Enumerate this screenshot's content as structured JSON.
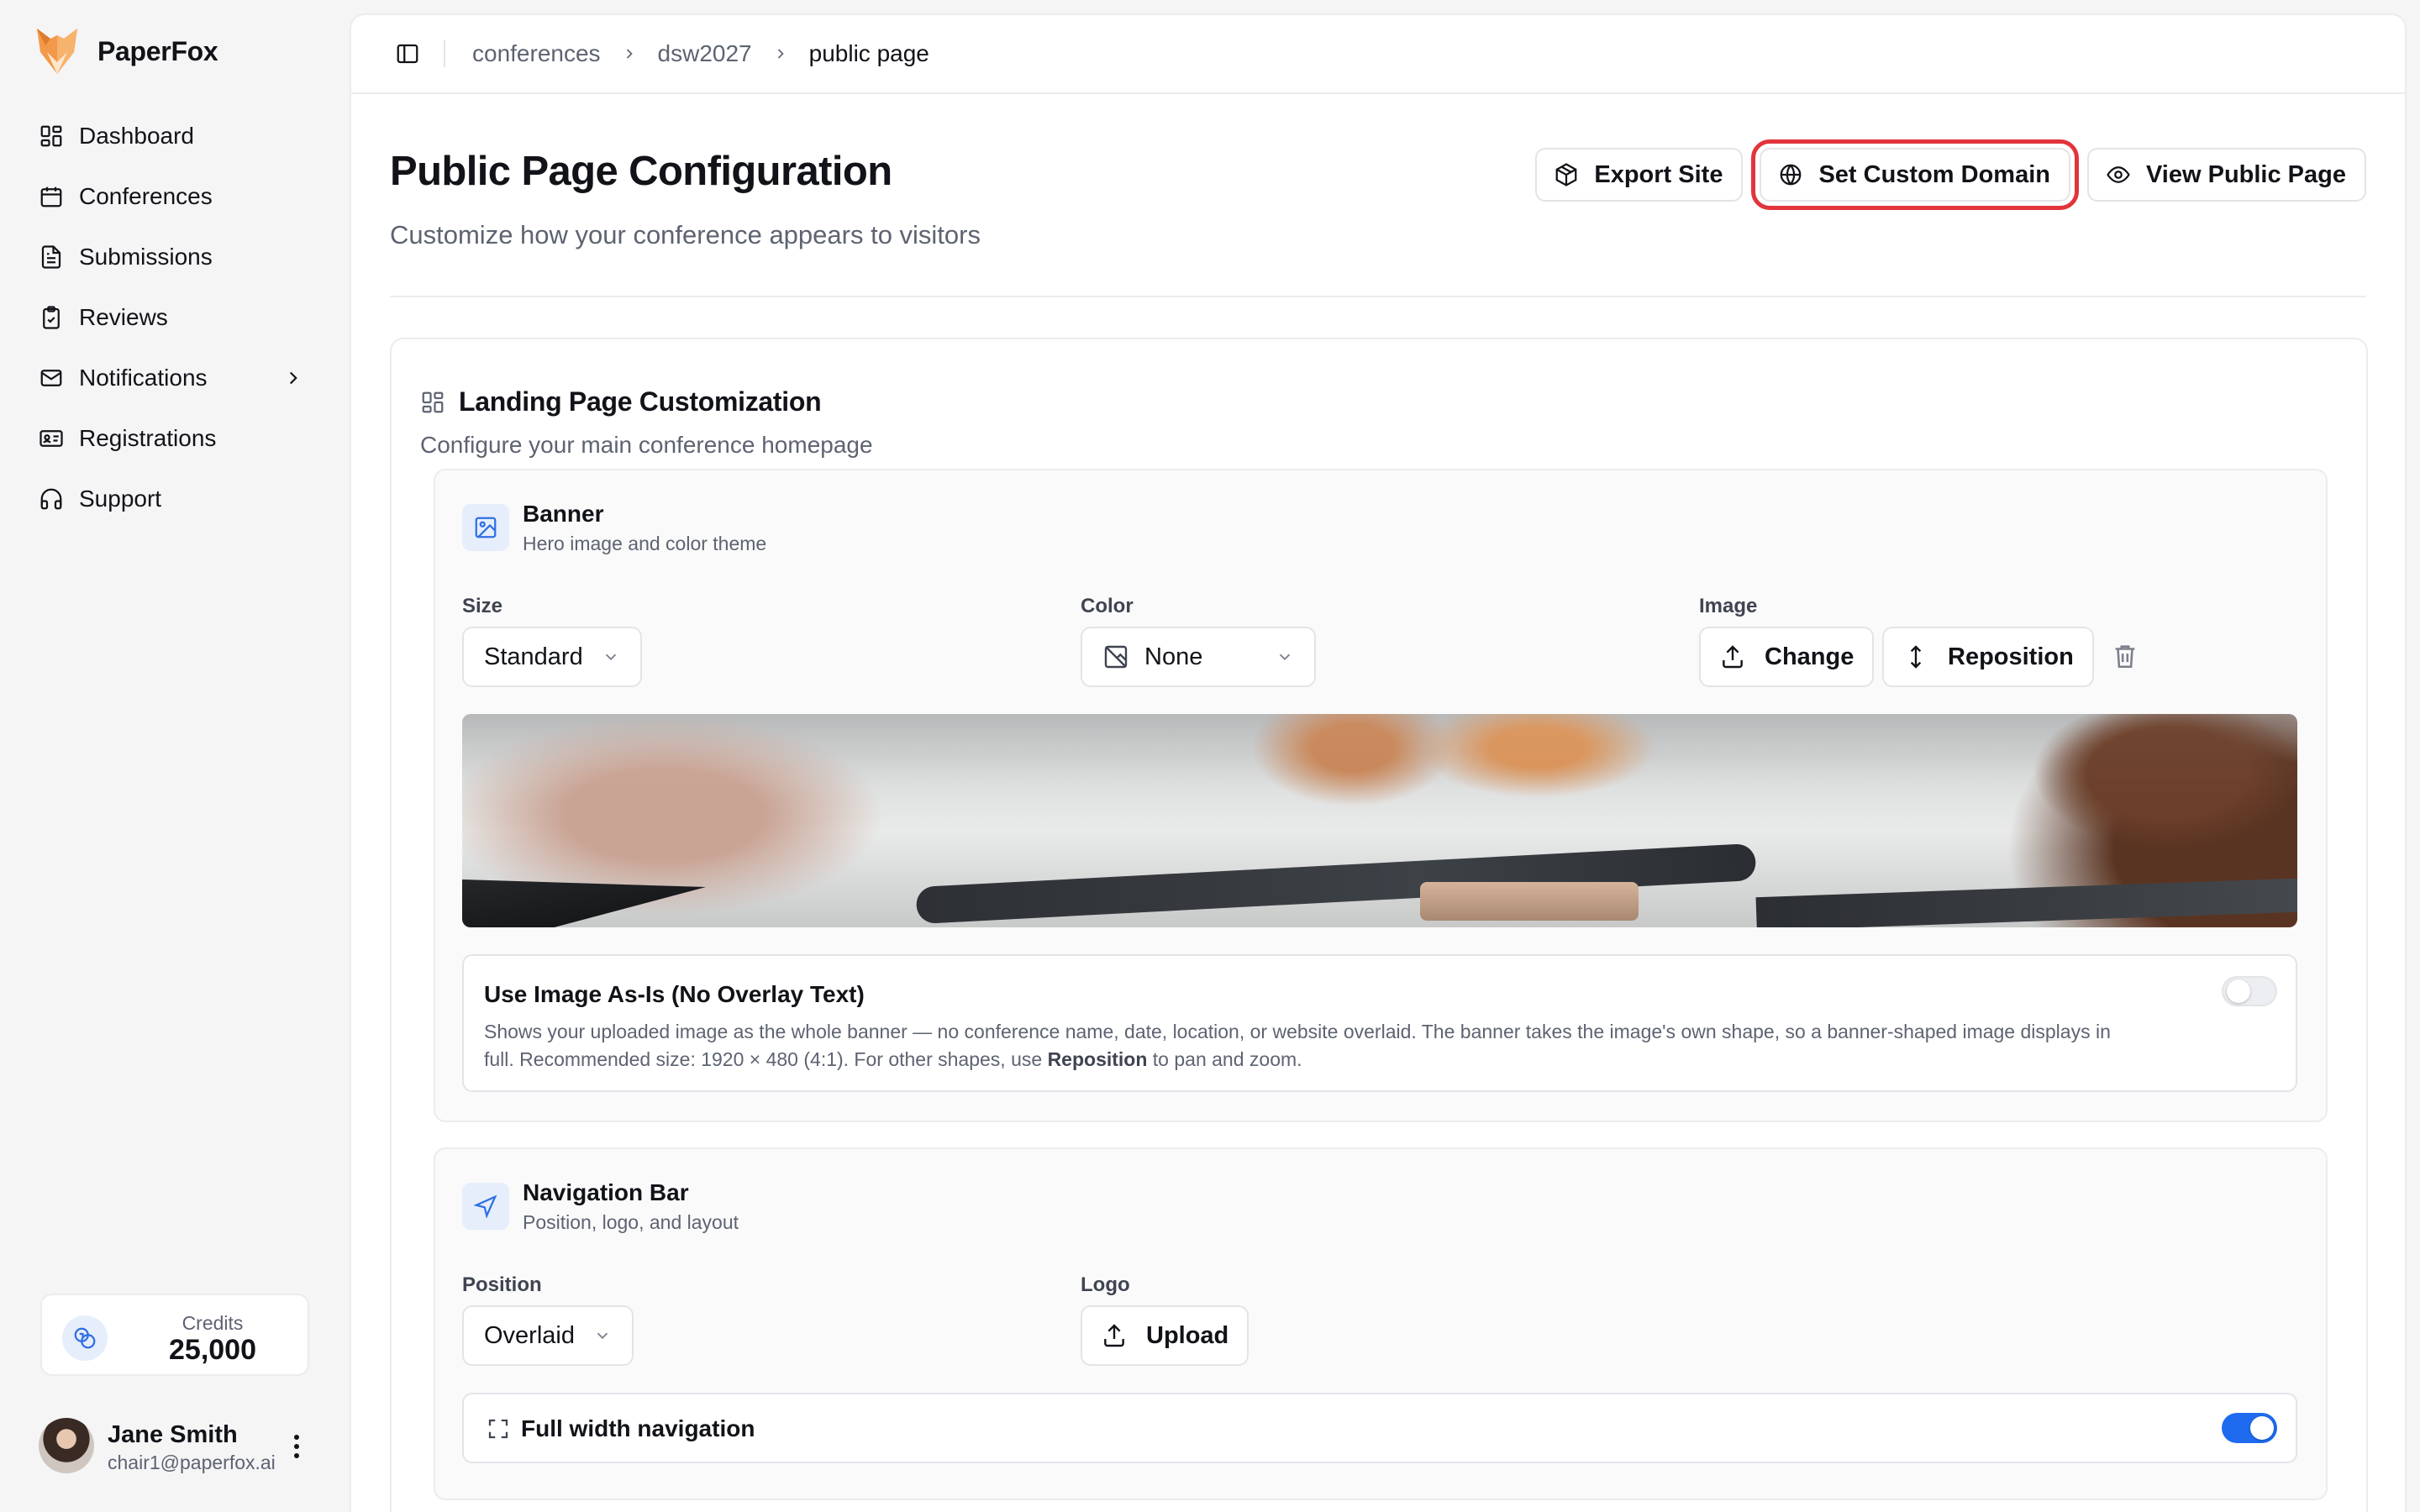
{
  "app": {
    "name": "PaperFox"
  },
  "sidebar": {
    "items": [
      {
        "label": "Dashboard",
        "icon": "dashboard-icon"
      },
      {
        "label": "Conferences",
        "icon": "calendar-icon"
      },
      {
        "label": "Submissions",
        "icon": "file-text-icon"
      },
      {
        "label": "Reviews",
        "icon": "clipboard-check-icon"
      },
      {
        "label": "Notifications",
        "icon": "mail-icon",
        "has_submenu": true
      },
      {
        "label": "Registrations",
        "icon": "id-card-icon"
      },
      {
        "label": "Support",
        "icon": "headphones-icon"
      }
    ],
    "credits": {
      "label": "Credits",
      "value": "25,000"
    },
    "user": {
      "name": "Jane Smith",
      "email": "chair1@paperfox.ai"
    }
  },
  "breadcrumb": {
    "items": [
      "conferences",
      "dsw2027"
    ],
    "current": "public page"
  },
  "header": {
    "title": "Public Page Configuration",
    "subtitle": "Customize how your conference appears to visitors",
    "actions": {
      "export": "Export Site",
      "custom_domain": "Set Custom Domain",
      "view_public": "View Public Page"
    }
  },
  "landing": {
    "title": "Landing Page Customization",
    "subtitle": "Configure your main conference homepage",
    "banner": {
      "title": "Banner",
      "subtitle": "Hero image and color theme",
      "size_label": "Size",
      "size_value": "Standard",
      "color_label": "Color",
      "color_value": "None",
      "image_label": "Image",
      "change_label": "Change",
      "reposition_label": "Reposition",
      "as_is": {
        "title": "Use Image As-Is (No Overlay Text)",
        "desc_part1": "Shows your uploaded image as the whole banner — no conference name, date, location, or website overlaid. The banner takes the image's own shape, so a banner-shaped image displays in full. Recommended size: 1920 × 480 (4:1). For other shapes, use ",
        "desc_bold": "Reposition",
        "desc_part2": " to pan and zoom.",
        "enabled": false
      }
    },
    "navigation": {
      "title": "Navigation Bar",
      "subtitle": "Position, logo, and layout",
      "position_label": "Position",
      "position_value": "Overlaid",
      "logo_label": "Logo",
      "upload_label": "Upload",
      "full_width_label": "Full width navigation",
      "full_width_enabled": true
    }
  },
  "colors": {
    "accent": "#1e6bf0",
    "highlight": "#e2343b",
    "brand": "#f0883e"
  }
}
